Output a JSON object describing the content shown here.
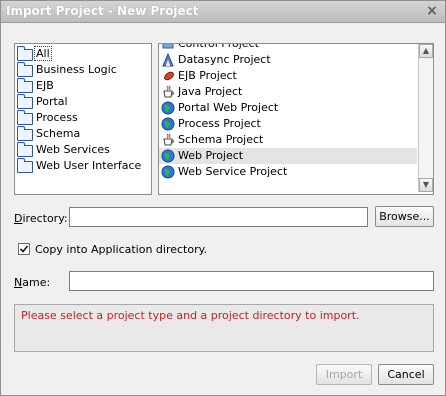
{
  "window": {
    "title": "Import Project - New Project",
    "close_glyph": "×"
  },
  "categories": {
    "items": [
      {
        "label": "All",
        "icon": "folder-icon",
        "selected": true
      },
      {
        "label": "Business Logic",
        "icon": "folder-icon"
      },
      {
        "label": "EJB",
        "icon": "folder-icon"
      },
      {
        "label": "Portal",
        "icon": "folder-icon"
      },
      {
        "label": "Process",
        "icon": "folder-icon"
      },
      {
        "label": "Schema",
        "icon": "folder-icon"
      },
      {
        "label": "Web Services",
        "icon": "folder-icon"
      },
      {
        "label": "Web User Interface",
        "icon": "folder-icon"
      }
    ]
  },
  "project_types": {
    "items": [
      {
        "label": "Control Project",
        "icon": "control-project-icon",
        "partially_visible": true
      },
      {
        "label": "Datasync Project",
        "icon": "datasync-project-icon"
      },
      {
        "label": "EJB Project",
        "icon": "ejb-project-icon"
      },
      {
        "label": "Java Project",
        "icon": "java-project-icon"
      },
      {
        "label": "Portal Web Project",
        "icon": "portal-web-project-icon"
      },
      {
        "label": "Process Project",
        "icon": "process-project-icon"
      },
      {
        "label": "Schema Project",
        "icon": "schema-project-icon"
      },
      {
        "label": "Web Project",
        "icon": "web-project-icon",
        "selected": true
      },
      {
        "label": "Web Service Project",
        "icon": "web-service-project-icon"
      }
    ],
    "scroll_up": "▲",
    "scroll_down": "▼"
  },
  "directory": {
    "label": "Directory:",
    "value": "",
    "browse_label": "Browse..."
  },
  "copy_option": {
    "label": "Copy into Application directory.",
    "checked": true
  },
  "name": {
    "label": "Name:",
    "value": ""
  },
  "message": "Please select a project type and a project directory to import.",
  "buttons": {
    "import_label": "Import",
    "cancel_label": "Cancel"
  },
  "colors": {
    "message_text": "#c81f1f",
    "selection": "#e4e4e4",
    "folder_border": "#2a55b7"
  }
}
